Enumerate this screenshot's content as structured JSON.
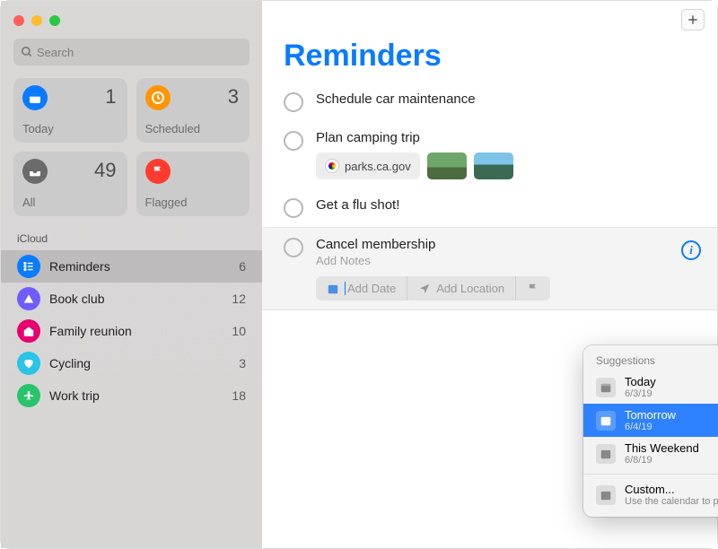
{
  "search": {
    "placeholder": "Search"
  },
  "smart": {
    "today": {
      "label": "Today",
      "count": "1",
      "color": "#0a7bff"
    },
    "scheduled": {
      "label": "Scheduled",
      "count": "3",
      "color": "#ff9500"
    },
    "all": {
      "label": "All",
      "count": "49",
      "color": "#6b6b6b"
    },
    "flagged": {
      "label": "Flagged",
      "count": "",
      "color": "#ff3b30"
    }
  },
  "section": "iCloud",
  "lists": [
    {
      "name": "Reminders",
      "count": "6",
      "color": "#0a7bff",
      "icon": "list",
      "active": true
    },
    {
      "name": "Book club",
      "count": "12",
      "color": "#6f5cff",
      "icon": "tent",
      "active": false
    },
    {
      "name": "Family reunion",
      "count": "10",
      "color": "#e8006f",
      "icon": "house",
      "active": false
    },
    {
      "name": "Cycling",
      "count": "3",
      "color": "#29c4e8",
      "icon": "heart",
      "active": false
    },
    {
      "name": "Work trip",
      "count": "18",
      "color": "#28c36a",
      "icon": "airplane",
      "active": false
    }
  ],
  "title": "Reminders",
  "reminders": [
    {
      "title": "Schedule car maintenance"
    },
    {
      "title": "Plan camping trip",
      "link": "parks.ca.gov",
      "thumbs": 2
    },
    {
      "title": "Get a flu shot!"
    },
    {
      "title": "Cancel membership",
      "notes_placeholder": "Add Notes",
      "editing": true
    }
  ],
  "edit_toolbar": {
    "add_date": "Add Date",
    "add_location": "Add Location"
  },
  "popover": {
    "header": "Suggestions",
    "items": [
      {
        "label": "Today",
        "sub": "6/3/19",
        "selected": false
      },
      {
        "label": "Tomorrow",
        "sub": "6/4/19",
        "selected": true
      },
      {
        "label": "This Weekend",
        "sub": "6/8/19",
        "selected": false
      }
    ],
    "custom": {
      "label": "Custom...",
      "sub": "Use the calendar to pick a date"
    }
  }
}
